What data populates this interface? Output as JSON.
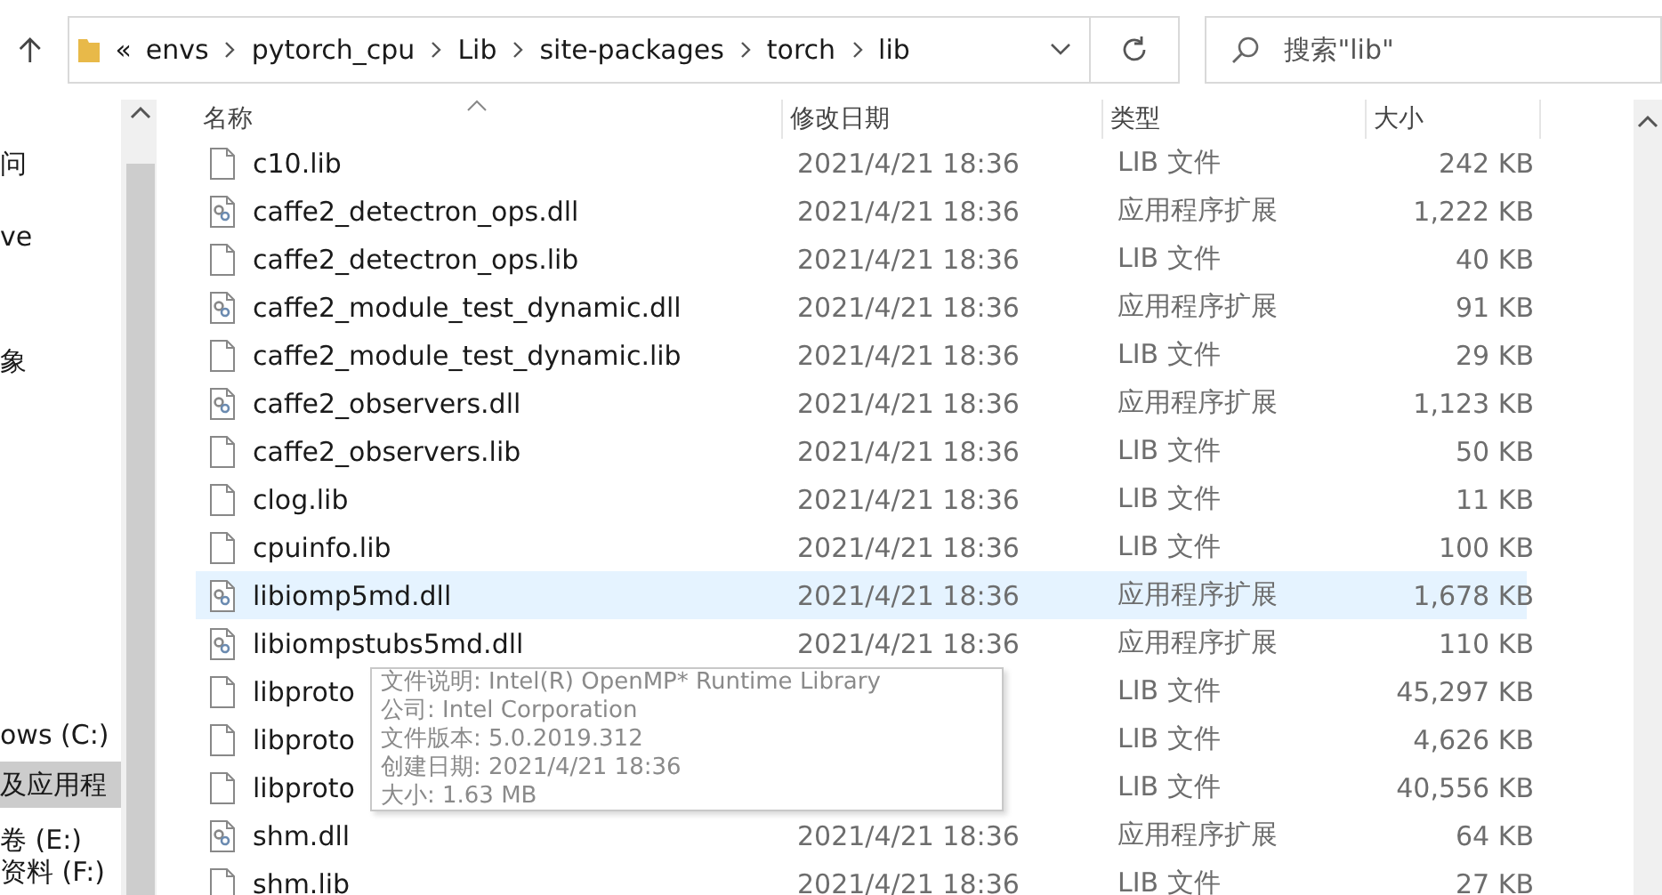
{
  "address_bar": {
    "overflow": "«",
    "path": [
      "envs",
      "pytorch_cpu",
      "Lib",
      "site-packages",
      "torch",
      "lib"
    ]
  },
  "search": {
    "placeholder": "搜索\"lib\""
  },
  "nav_pane": {
    "items": [
      {
        "label": "问",
        "selected": false
      },
      {
        "label": "ve",
        "selected": false
      },
      {
        "label": "象",
        "selected": false
      },
      {
        "label": "ows (C:)",
        "selected": false
      },
      {
        "label": "及应用程",
        "selected": true
      },
      {
        "label": "卷 (E:)",
        "selected": false
      },
      {
        "label": "资料 (F:)",
        "selected": false
      }
    ]
  },
  "table": {
    "columns": [
      "名称",
      "修改日期",
      "类型",
      "大小"
    ],
    "rows": [
      {
        "kind": "lib",
        "name": "c10.lib",
        "date": "2021/4/21 18:36",
        "type": "LIB 文件",
        "size": "242 KB",
        "selected": false
      },
      {
        "kind": "dll",
        "name": "caffe2_detectron_ops.dll",
        "date": "2021/4/21 18:36",
        "type": "应用程序扩展",
        "size": "1,222 KB",
        "selected": false
      },
      {
        "kind": "lib",
        "name": "caffe2_detectron_ops.lib",
        "date": "2021/4/21 18:36",
        "type": "LIB 文件",
        "size": "40 KB",
        "selected": false
      },
      {
        "kind": "dll",
        "name": "caffe2_module_test_dynamic.dll",
        "date": "2021/4/21 18:36",
        "type": "应用程序扩展",
        "size": "91 KB",
        "selected": false
      },
      {
        "kind": "lib",
        "name": "caffe2_module_test_dynamic.lib",
        "date": "2021/4/21 18:36",
        "type": "LIB 文件",
        "size": "29 KB",
        "selected": false
      },
      {
        "kind": "dll",
        "name": "caffe2_observers.dll",
        "date": "2021/4/21 18:36",
        "type": "应用程序扩展",
        "size": "1,123 KB",
        "selected": false
      },
      {
        "kind": "lib",
        "name": "caffe2_observers.lib",
        "date": "2021/4/21 18:36",
        "type": "LIB 文件",
        "size": "50 KB",
        "selected": false
      },
      {
        "kind": "lib",
        "name": "clog.lib",
        "date": "2021/4/21 18:36",
        "type": "LIB 文件",
        "size": "11 KB",
        "selected": false
      },
      {
        "kind": "lib",
        "name": "cpuinfo.lib",
        "date": "2021/4/21 18:36",
        "type": "LIB 文件",
        "size": "100 KB",
        "selected": false
      },
      {
        "kind": "dll",
        "name": "libiomp5md.dll",
        "date": "2021/4/21 18:36",
        "type": "应用程序扩展",
        "size": "1,678 KB",
        "selected": true
      },
      {
        "kind": "dll",
        "name": "libiompstubs5md.dll",
        "date": "2021/4/21 18:36",
        "type": "应用程序扩展",
        "size": "110 KB",
        "selected": false
      },
      {
        "kind": "lib",
        "name": "libproto",
        "type": "LIB 文件",
        "size": "45,297 KB",
        "selected": false
      },
      {
        "kind": "lib",
        "name": "libproto",
        "type": "LIB 文件",
        "size": "4,626 KB",
        "selected": false
      },
      {
        "kind": "lib",
        "name": "libproto",
        "type": "LIB 文件",
        "size": "40,556 KB",
        "selected": false
      },
      {
        "kind": "dll",
        "name": "shm.dll",
        "date": "2021/4/21 18:36",
        "type": "应用程序扩展",
        "size": "64 KB",
        "selected": false
      },
      {
        "kind": "lib",
        "name": "shm.lib",
        "date": "2021/4/21 18:36",
        "type": "LIB 文件",
        "size": "27 KB",
        "selected": false
      }
    ]
  },
  "tooltip": {
    "lines": [
      "文件说明: Intel(R) OpenMP* Runtime Library",
      "公司: Intel Corporation",
      "文件版本: 5.0.2019.312",
      "创建日期: 2021/4/21 18:36",
      "大小: 1.63 MB"
    ]
  }
}
